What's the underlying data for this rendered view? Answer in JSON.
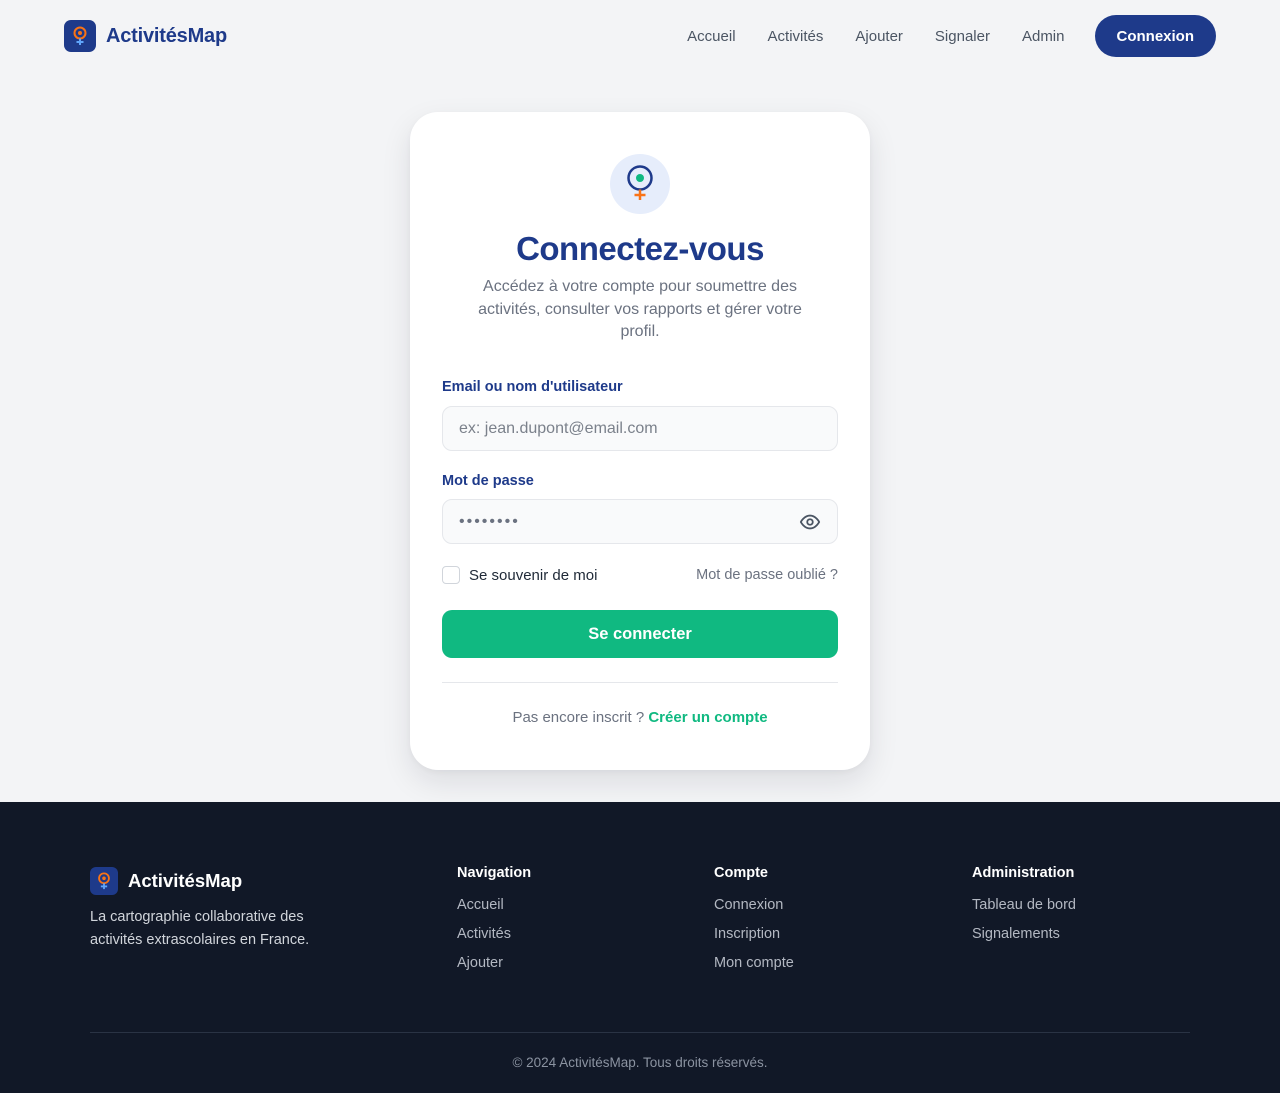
{
  "brand": {
    "name": "ActivitésMap"
  },
  "nav": {
    "items": [
      "Accueil",
      "Activités",
      "Ajouter",
      "Signaler",
      "Admin"
    ],
    "login_label": "Connexion"
  },
  "login": {
    "title": "Connectez-vous",
    "subtitle": "Accédez à votre compte pour soumettre des activités, consulter vos rapports et gérer votre profil.",
    "email_label": "Email ou nom d'utilisateur",
    "email_placeholder": "ex: jean.dupont@email.com",
    "password_label": "Mot de passe",
    "password_value": "••••••••",
    "remember_label": "Se souvenir de moi",
    "forgot_label": "Mot de passe oublié ?",
    "submit_label": "Se connecter",
    "signup_prompt": "Pas encore inscrit ?",
    "signup_link": "Créer un compte"
  },
  "footer": {
    "tagline": "La cartographie collaborative des activités extrascolaires en France.",
    "columns": [
      {
        "title": "Navigation",
        "links": [
          "Accueil",
          "Activités",
          "Ajouter"
        ]
      },
      {
        "title": "Compte",
        "links": [
          "Connexion",
          "Inscription",
          "Mon compte"
        ]
      },
      {
        "title": "Administration",
        "links": [
          "Tableau de bord",
          "Signalements"
        ]
      }
    ],
    "copyright": "© 2024 ActivitésMap. Tous droits réservés."
  },
  "colors": {
    "primary": "#1e3a8a",
    "accent": "#10b981",
    "marker_orange": "#f97316",
    "footer_bg": "#111827"
  },
  "icons": {
    "logo": "map-pin-icon",
    "card": "map-pin-icon",
    "password_toggle": "eye-icon"
  }
}
